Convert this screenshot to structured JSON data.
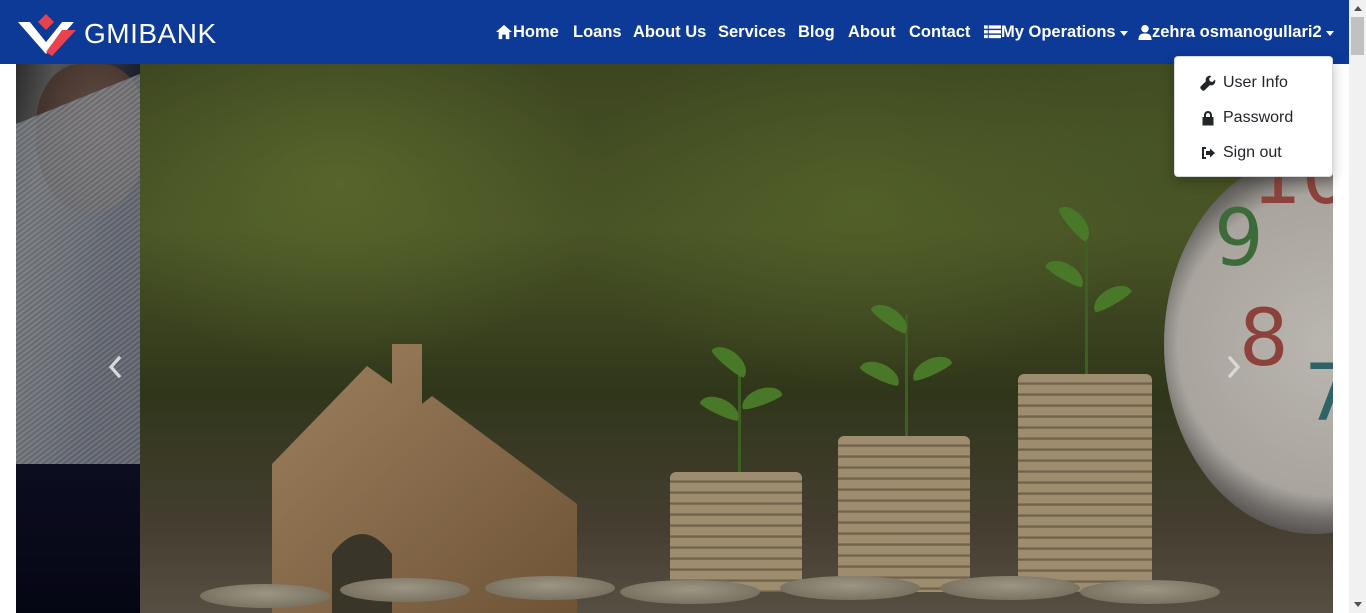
{
  "brand": {
    "name": "GMIBANK",
    "logo_icon": "gmibank-logo-icon"
  },
  "nav": {
    "home": "Home",
    "loans": "Loans",
    "about_us": "About Us",
    "services": "Services",
    "blog": "Blog",
    "about": "About",
    "contact": "Contact",
    "my_operations": "My Operations",
    "user": "zehra osmanogullari2"
  },
  "user_menu": {
    "items": [
      {
        "label": "User Info",
        "icon": "wrench-icon"
      },
      {
        "label": "Password",
        "icon": "lock-icon"
      },
      {
        "label": "Sign out",
        "icon": "sign-out-icon"
      }
    ]
  },
  "carousel": {
    "clock_numbers": [
      "10",
      "9",
      "8",
      "7"
    ],
    "prev_icon": "chevron-left-icon",
    "next_icon": "chevron-right-icon"
  },
  "colors": {
    "navbar": "#0d3997",
    "logo_red": "#e8424f",
    "dropdown_bg": "#ffffff"
  }
}
